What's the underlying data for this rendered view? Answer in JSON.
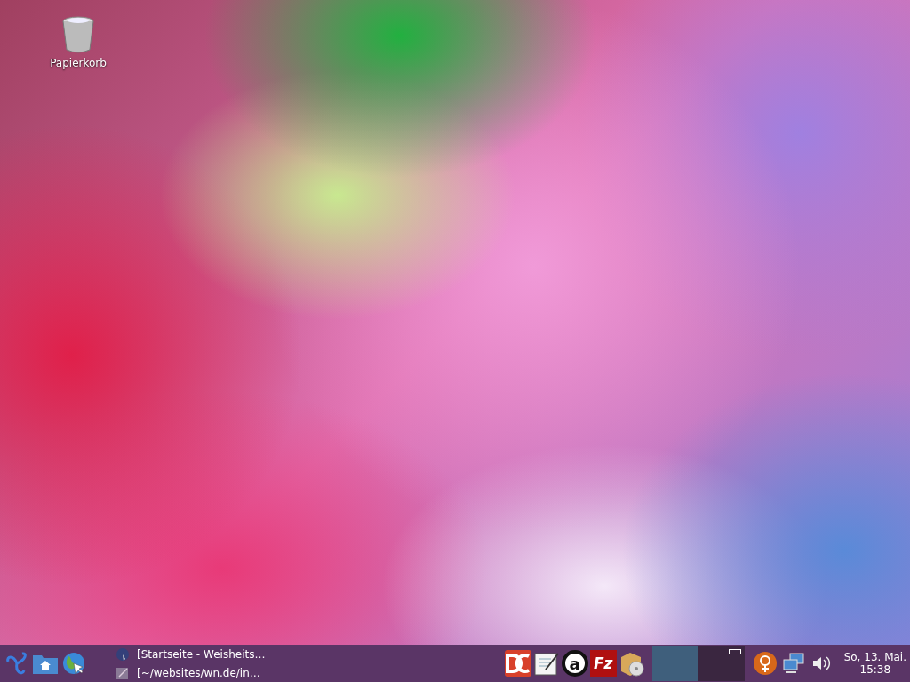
{
  "desktop_icons": [
    {
      "kind": "trash",
      "label": "Papierkorb"
    }
  ],
  "taskbar": {
    "quicklaunch": [
      {
        "kind": "menu"
      },
      {
        "kind": "home"
      },
      {
        "kind": "browser"
      }
    ],
    "tasks": [
      {
        "kind": "browser",
        "title": "[Startseite - Weisheits…"
      },
      {
        "kind": "editor",
        "title": "[~/websites/wn.de/in…"
      }
    ],
    "launchers": [
      {
        "kind": "dc"
      },
      {
        "kind": "notes"
      },
      {
        "kind": "circle",
        "glyph": "a"
      },
      {
        "kind": "ftp",
        "glyph": "Fz"
      },
      {
        "kind": "installer"
      }
    ],
    "pager": [
      {
        "selected": true,
        "has_window": false
      },
      {
        "selected": false,
        "has_window": true
      }
    ],
    "tray": [
      {
        "kind": "orange"
      },
      {
        "kind": "network"
      },
      {
        "kind": "volume"
      }
    ],
    "clock": {
      "date": "So, 13. Mai.",
      "time": "15:38"
    }
  }
}
